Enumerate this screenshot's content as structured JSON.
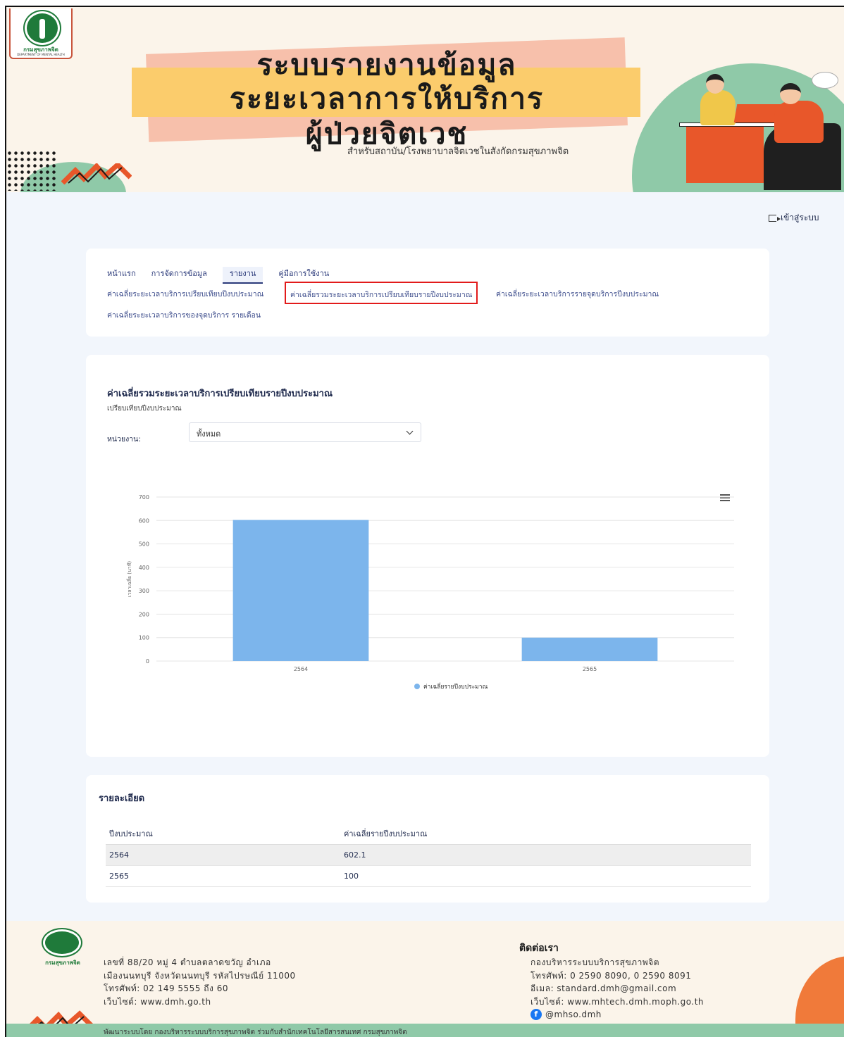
{
  "banner": {
    "logo_text": "กรมสุขภาพจิต",
    "logo_subtext": "DEPARTMENT OF MENTAL HEALTH",
    "title_line1": "ระบบรายงานข้อมูล",
    "title_line2": "ระยะเวลาการให้บริการ",
    "title_line3": "ผู้ป่วยจิตเวช",
    "subtitle": "สำหรับสถาบัน/โรงพยาบาลจิตเวชในสังกัดกรมสุขภาพจิต"
  },
  "header": {
    "login_label": "เข้าสู่ระบบ"
  },
  "nav": {
    "tabs": [
      {
        "label": "หน้าแรก",
        "active": false
      },
      {
        "label": "การจัดการข้อมูล",
        "active": false
      },
      {
        "label": "รายงาน",
        "active": true
      },
      {
        "label": "คู่มือการใช้งาน",
        "active": false
      }
    ],
    "sub_links": [
      "ค่าเฉลี่ยระยะเวลาบริการเปรียบเทียบปีงบประมาณ",
      "ค่าเฉลี่ยรวมระยะเวลาบริการเปรียบเทียบรายปีงบประมาณ",
      "ค่าเฉลี่ยระยะเวลาบริการรายจุดบริการปีงบประมาณ",
      "ค่าเฉลี่ยระยะเวลาบริการของจุดบริการ รายเดือน"
    ]
  },
  "report": {
    "title": "ค่าเฉลี่ยรวมระยะเวลาบริการเปรียบเทียบรายปีงบประมาณ",
    "subtitle": "เปรียบเทียบปีงบประมาณ",
    "unit_label": "หน่วยงาน:",
    "unit_selected": "ทั้งหมด"
  },
  "chart_data": {
    "type": "bar",
    "categories": [
      "2564",
      "2565"
    ],
    "series": [
      {
        "name": "ค่าเฉลี่ยรายปีงบประมาณ",
        "values": [
          602.1,
          100
        ]
      }
    ],
    "ylabel": "เวลาเฉลี่ย (นาที)",
    "xlabel": "",
    "ylim": [
      0,
      700
    ],
    "yticks": [
      0,
      100,
      200,
      300,
      400,
      500,
      600,
      700
    ],
    "grid": true,
    "legend_position": "bottom-center",
    "bar_color": "#7cb5ec"
  },
  "detail": {
    "title": "รายละเอียด",
    "columns": [
      "ปีงบประมาณ",
      "ค่าเฉลี่ยรายปีงบประมาณ"
    ],
    "rows": [
      [
        "2564",
        "602.1"
      ],
      [
        "2565",
        "100"
      ]
    ]
  },
  "footer": {
    "logo_text": "กรมสุขภาพจิต",
    "address_lines": [
      "เลขที่ 88/20 หมู่ 4 ตำบลตลาดขวัญ อำเภอ",
      "เมืองนนทบุรี จังหวัดนนทบุรี รหัสไปรษณีย์ 11000",
      "โทรศัพท์: 02 149 5555 ถึง 60",
      "เว็บไซต์: www.dmh.go.th"
    ],
    "contact_title": "ติดต่อเรา",
    "contact_lines": [
      "กองบริหารระบบบริการสุขภาพจิต",
      "โทรศัพท์: 0 2590 8090, 0 2590 8091",
      "อีเมล: standard.dmh@gmail.com",
      "เว็บไซต์: www.mhtech.dmh.moph.go.th"
    ],
    "facebook": "@mhso.dmh",
    "credit": "พัฒนาระบบโดย กองบริหารระบบบริการสุขภาพจิต ร่วมกับสำนักเทคโนโลยีสารสนเทศ กรมสุขภาพจิต"
  }
}
